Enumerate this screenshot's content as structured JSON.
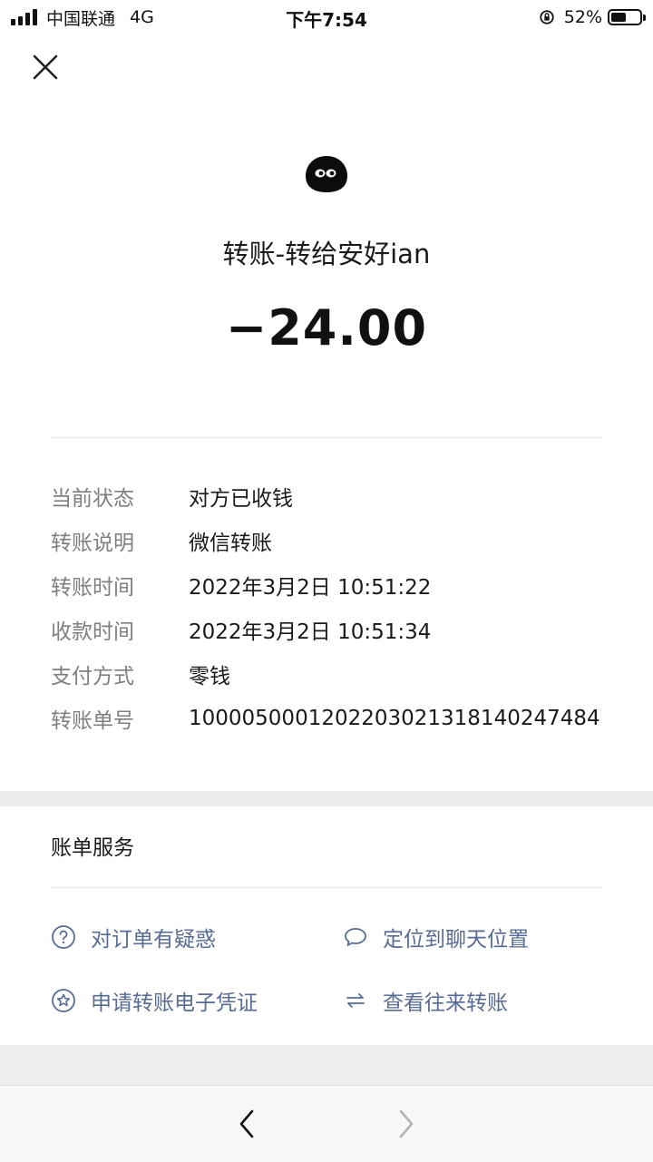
{
  "status_bar": {
    "carrier": "中国联通",
    "network": "4G",
    "time": "下午7:54",
    "battery_percent": "52%",
    "icons": [
      "signal-icon",
      "orientation-lock-icon",
      "battery-icon"
    ]
  },
  "header": {
    "close_icon": "close-icon"
  },
  "transfer": {
    "title": "转账-转给安好ian",
    "amount": "−24.00"
  },
  "details": [
    {
      "label": "当前状态",
      "value": "对方已收钱"
    },
    {
      "label": "转账说明",
      "value": "微信转账"
    },
    {
      "label": "转账时间",
      "value": "2022年3月2日 10:51:22"
    },
    {
      "label": "收款时间",
      "value": "2022年3月2日 10:51:34"
    },
    {
      "label": "支付方式",
      "value": "零钱"
    },
    {
      "label": "转账单号",
      "value": "100005000120220302131814024 7484"
    }
  ],
  "services": {
    "title": "账单服务",
    "items": [
      {
        "label": "对订单有疑惑",
        "icon": "question-circle-icon"
      },
      {
        "label": "定位到聊天位置",
        "icon": "chat-bubble-icon"
      },
      {
        "label": "申请转账电子凭证",
        "icon": "star-circle-icon"
      },
      {
        "label": "查看往来转账",
        "icon": "swap-arrows-icon"
      }
    ]
  },
  "colors": {
    "link": "#576b95",
    "label": "#7f7f7f",
    "text": "#1a1a1a"
  },
  "nav": {
    "back_icon": "chevron-left-icon",
    "forward_icon": "chevron-right-icon"
  }
}
